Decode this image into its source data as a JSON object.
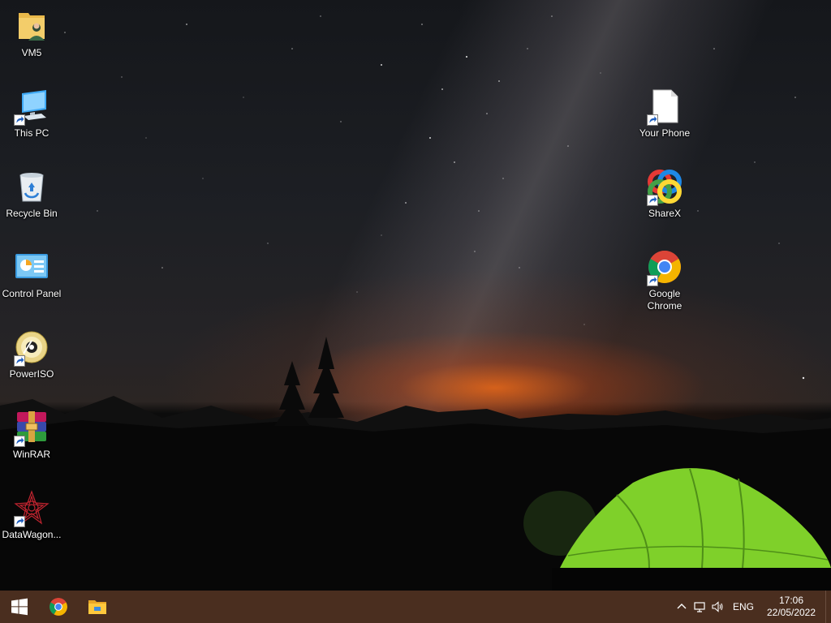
{
  "desktop": {
    "icons": [
      {
        "label": "VM5",
        "icon": "user-folder-icon"
      },
      {
        "label": "This PC",
        "icon": "computer-icon"
      },
      {
        "label": "Recycle Bin",
        "icon": "recycle-bin-icon"
      },
      {
        "label": "Control Panel",
        "icon": "control-panel-icon"
      },
      {
        "label": "PowerISO",
        "icon": "disc-icon"
      },
      {
        "label": "WinRAR",
        "icon": "archive-icon"
      },
      {
        "label": "DataWagon...",
        "icon": "datawagon-icon"
      },
      {
        "label": "Your Phone",
        "icon": "blank-file-icon"
      },
      {
        "label": "ShareX",
        "icon": "sharex-icon"
      },
      {
        "label": "Google Chrome",
        "icon": "chrome-icon"
      }
    ]
  },
  "taskbar": {
    "pinned": [
      "start-icon",
      "chrome-icon",
      "file-explorer-icon"
    ],
    "tray": {
      "language": "ENG",
      "time": "17:06",
      "date": "22/05/2022"
    },
    "color": "#4a2e1f"
  },
  "colors": {
    "tent": "#7fd02a",
    "sunset": "#ff6e14"
  }
}
